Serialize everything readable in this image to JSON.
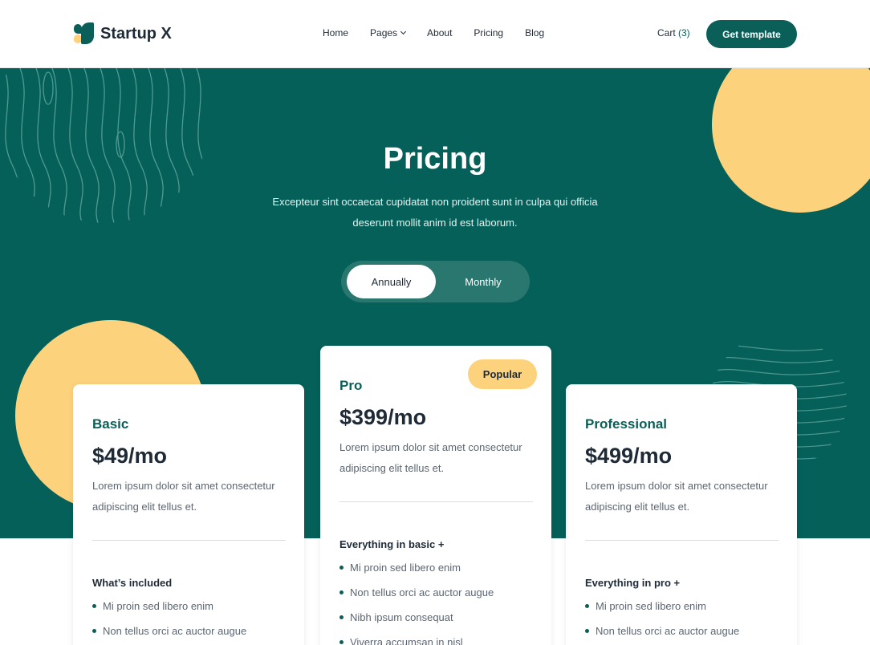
{
  "nav": {
    "brand": "Startup X",
    "menu": [
      {
        "label": "Home"
      },
      {
        "label": "Pages"
      },
      {
        "label": "About"
      },
      {
        "label": "Pricing"
      },
      {
        "label": "Blog"
      }
    ],
    "cart_label": "Cart",
    "cart_count": "(3)",
    "cta": "Get template"
  },
  "hero": {
    "title": "Pricing",
    "subtitle": "Excepteur sint occaecat cupidatat non proident sunt in culpa qui officia deserunt mollit anim id est laborum.",
    "toggle": {
      "active": "Annually",
      "inactive": "Monthly"
    }
  },
  "plans": [
    {
      "name": "Basic",
      "price": "$49/mo",
      "description": "Lorem ipsum dolor sit amet consectetur adipiscing elit tellus et.",
      "includes_title": "What’s included",
      "features": [
        "Mi proin sed libero enim",
        "Non tellus orci ac auctor augue"
      ]
    },
    {
      "name": "Pro",
      "badge": "Popular",
      "price": "$399/mo",
      "description": "Lorem ipsum dolor sit amet consectetur adipiscing elit tellus et.",
      "includes_title": "Everything in basic +",
      "features": [
        "Mi proin sed libero enim",
        "Non tellus orci ac auctor augue",
        "Nibh ipsum consequat",
        "Viverra accumsan in nisl"
      ]
    },
    {
      "name": "Professional",
      "price": "$499/mo",
      "description": "Lorem ipsum dolor sit amet consectetur adipiscing elit tellus et.",
      "includes_title": "Everything in pro +",
      "features": [
        "Mi proin sed libero enim",
        "Non tellus orci ac auctor augue"
      ]
    }
  ],
  "colors": {
    "brand": "#05605a",
    "accent": "#fcd27d"
  }
}
